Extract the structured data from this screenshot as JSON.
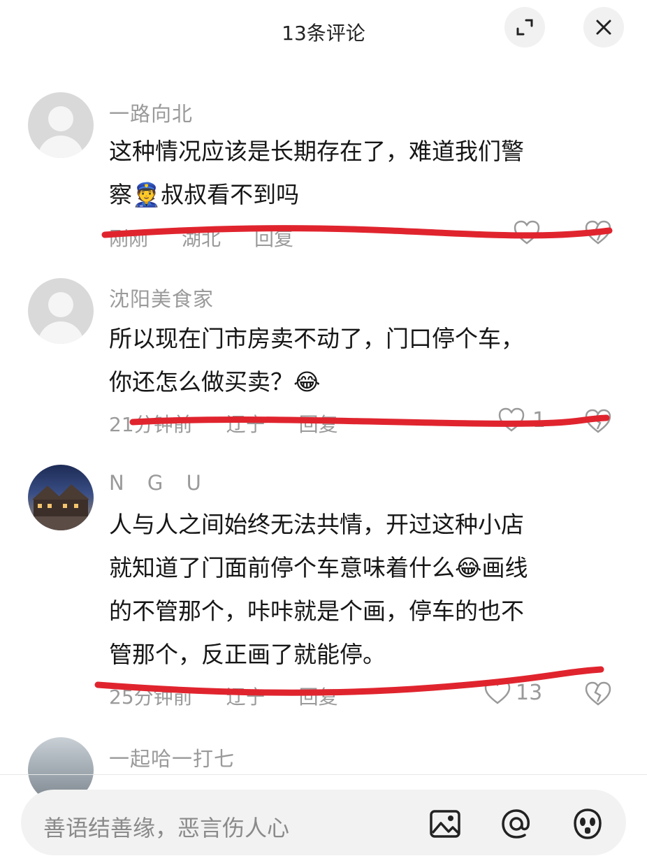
{
  "header": {
    "title": "13条评论"
  },
  "comments": [
    {
      "username": "一路向北",
      "text_lines": [
        "这种情况应该是长期存在了，难道我们警",
        "察👮叔叔看不到吗"
      ],
      "time": "刚刚",
      "location": "湖北",
      "reply_label": "回复",
      "like_count": ""
    },
    {
      "username": "沈阳美食家",
      "text_lines": [
        "所以现在门市房卖不动了，门口停个车，",
        "你还怎么做买卖？😂"
      ],
      "time": "21分钟前",
      "location": "辽宁",
      "reply_label": "回复",
      "like_count": "1"
    },
    {
      "username": "N G U",
      "text_lines": [
        "人与人之间始终无法共情，开过这种小店",
        "就知道了门面前停个车意味着什么😂画线",
        "的不管那个，咔咔就是个画，停车的也不",
        "管那个，反正画了就能停。"
      ],
      "time": "25分钟前",
      "location": "辽宁",
      "reply_label": "回复",
      "like_count": "13"
    },
    {
      "username": "一起哈一打七"
    }
  ],
  "input": {
    "placeholder": "善语结善缘，恶言伤人心"
  },
  "colors": {
    "annotation_red": "#e0242e",
    "muted_text": "#9a9a9a",
    "input_bg": "#f2f2f2"
  },
  "icons": [
    "expand-icon",
    "close-icon",
    "heart-icon",
    "broken-heart-icon",
    "image-icon",
    "at-icon",
    "emoji-icon"
  ]
}
